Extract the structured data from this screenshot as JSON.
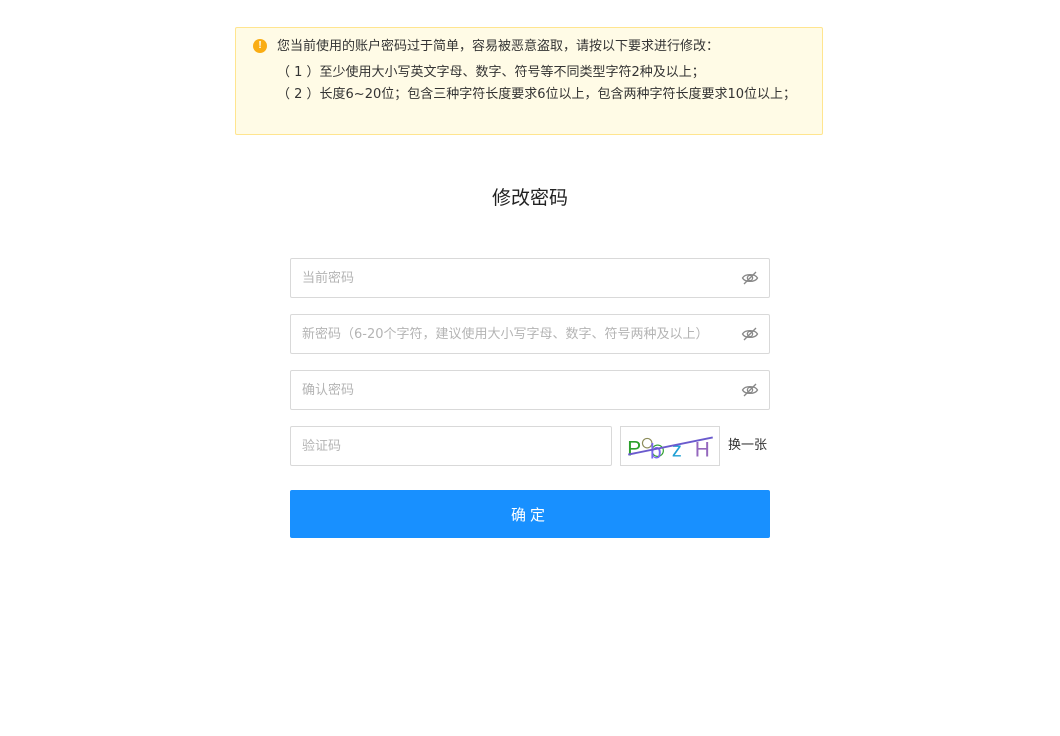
{
  "warning": {
    "icon": "info-circle-icon",
    "icon_color": "#faad14",
    "title": "您当前使用的账户密码过于简单，容易被恶意盗取，请按以下要求进行修改：",
    "rules": [
      "（ 1 ）至少使用大小写英文字母、数字、符号等不同类型字符2种及以上；",
      "（ 2 ）长度6~20位；包含三种字符长度要求6位以上，包含两种字符长度要求10位以上；"
    ]
  },
  "form": {
    "title": "修改密码",
    "current_password": {
      "placeholder": "当前密码",
      "value": "",
      "toggle_icon": "eye-hidden-icon"
    },
    "new_password": {
      "placeholder": "新密码（6-20个字符，建议使用大小写字母、数字、符号两种及以上）",
      "value": "",
      "toggle_icon": "eye-hidden-icon"
    },
    "confirm_password": {
      "placeholder": "确认密码",
      "value": "",
      "toggle_icon": "eye-hidden-icon"
    },
    "captcha": {
      "placeholder": "验证码",
      "value": "",
      "image_text": [
        "P",
        "b",
        "z",
        "H"
      ],
      "image_colors": [
        "#2ca02c",
        "#7b68ee",
        "#1f9fd4",
        "#9467bd"
      ],
      "refresh_label": "换一张"
    },
    "submit_label": "确定",
    "accent_color": "#1890ff"
  }
}
